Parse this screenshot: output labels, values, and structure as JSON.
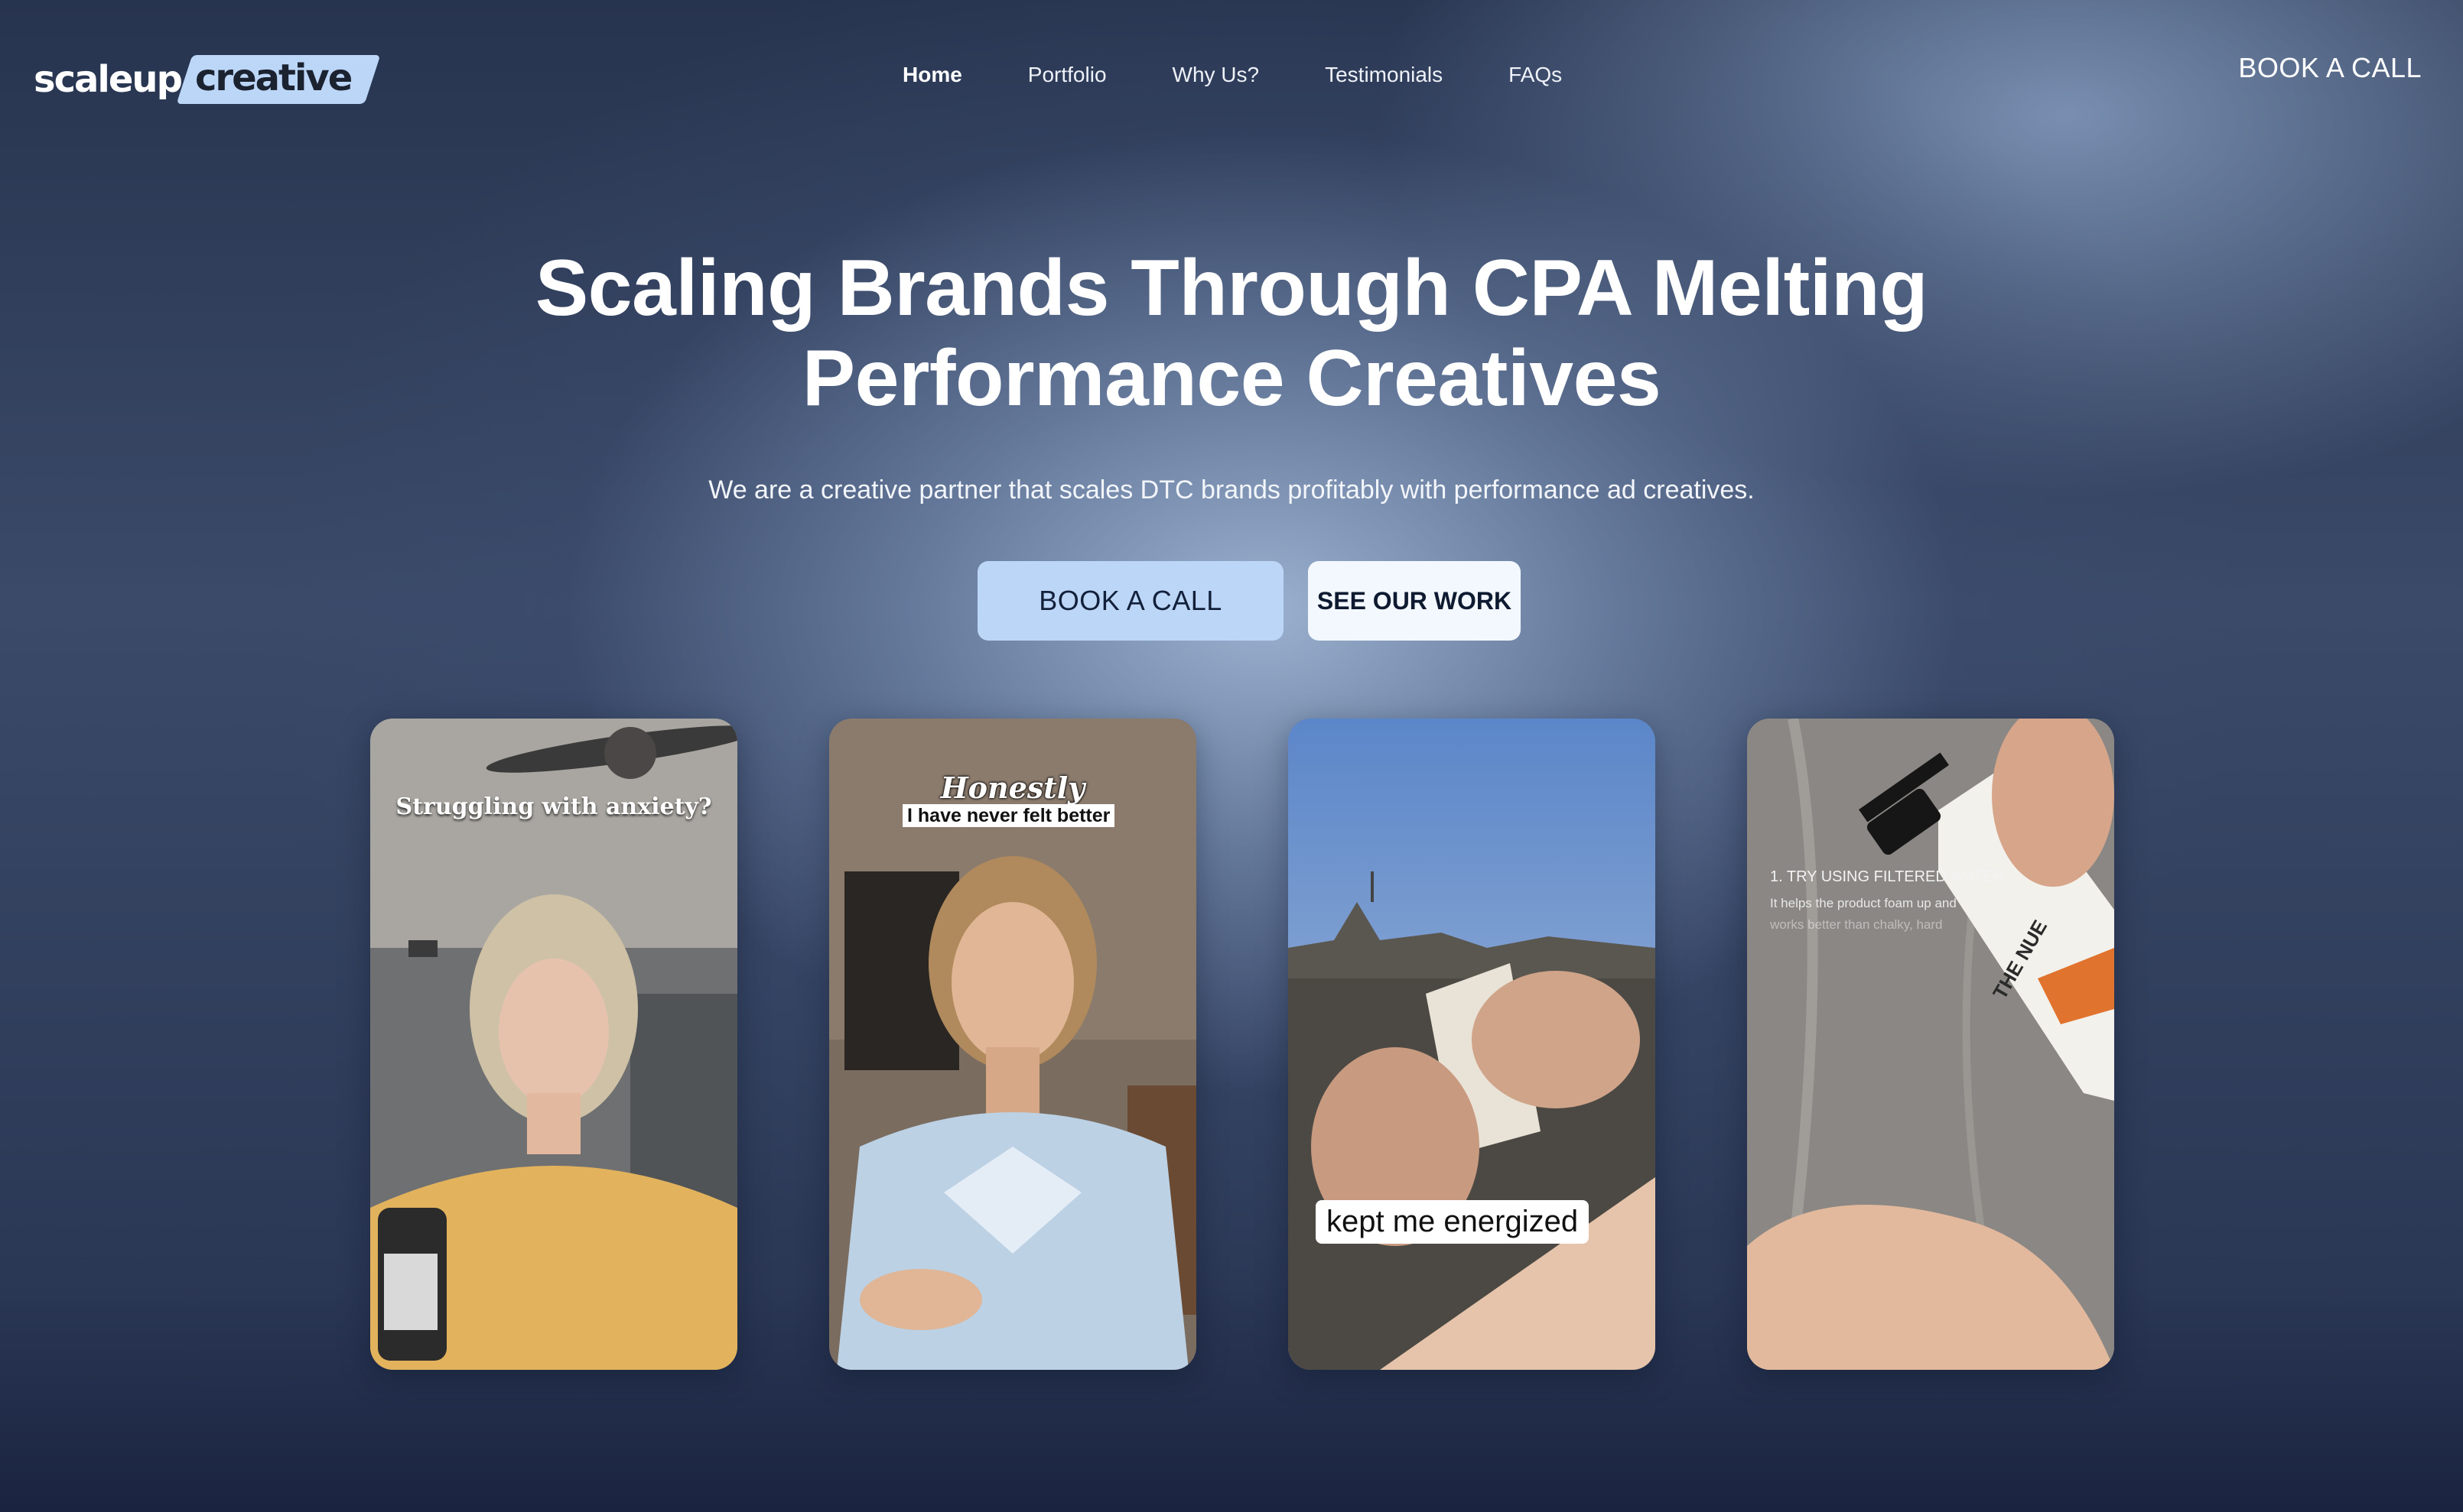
{
  "header": {
    "logo_part1": "scaleup",
    "logo_part2": "creative",
    "nav": [
      {
        "label": "Home"
      },
      {
        "label": "Portfolio"
      },
      {
        "label": "Why Us?"
      },
      {
        "label": "Testimonials"
      },
      {
        "label": "FAQs"
      }
    ],
    "cta_label": "BOOK A CALL"
  },
  "hero": {
    "title_line1": "Scaling Brands Through CPA Melting",
    "title_line2": "Performance Creatives",
    "subtitle": "We are a creative partner that scales DTC brands profitably with performance ad creatives.",
    "primary_button": "BOOK A CALL",
    "secondary_button": "SEE OUR WORK"
  },
  "cards": [
    {
      "caption": "Struggling with anxiety?"
    },
    {
      "caption_script": "Honestly",
      "caption_box": "I have never felt better"
    },
    {
      "caption_box": "kept me energized"
    },
    {
      "step": "1.  TRY USING FILTERED WATER",
      "text1": "It helps the product foam up and",
      "text2": "works better than chalky, hard",
      "bottle_label": "THE NUE"
    }
  ],
  "colors": {
    "accent": "#bcd6f8",
    "secondary_button_bg": "#f3f8ff",
    "dark_text": "#13203a"
  }
}
